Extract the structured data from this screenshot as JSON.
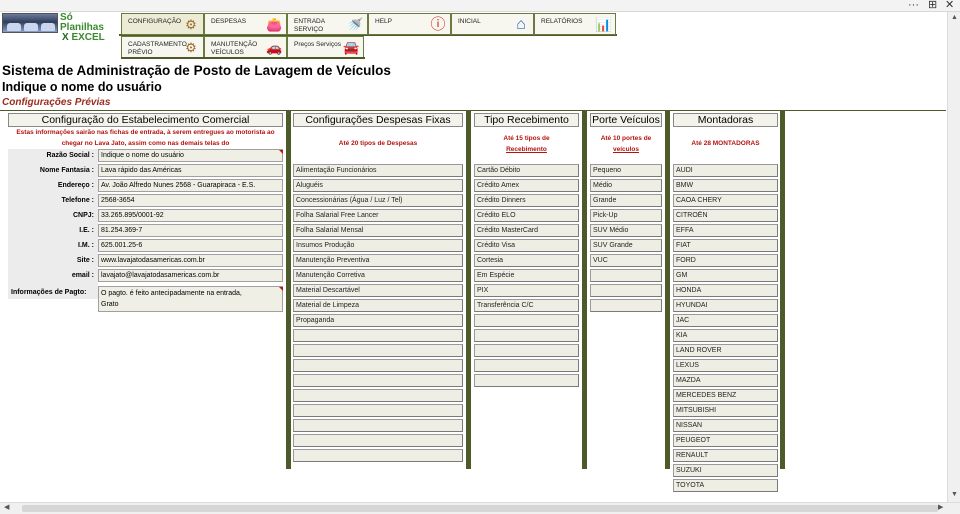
{
  "window": {
    "controls": [
      "···",
      "⊞",
      "✕"
    ]
  },
  "logo": {
    "line1": "Só Planilhas",
    "line2_x": "X",
    "line2": "EXCEL"
  },
  "menu": {
    "row1": [
      {
        "label": "CONFIGURAÇÃO",
        "icon": "gears-icon",
        "glyph": "⚙"
      },
      {
        "label": "DESPESAS",
        "icon": "wallet-icon",
        "glyph": "👛"
      },
      {
        "label": "ENTRADA SERVIÇO",
        "icon": "car-wash-icon",
        "glyph": "🚿"
      },
      {
        "label": "HELP",
        "icon": "info-icon",
        "glyph": "ⓘ"
      },
      {
        "label": "INICIAL",
        "icon": "home-icon",
        "glyph": "⌂"
      },
      {
        "label": "RELATÓRIOS",
        "icon": "report-icon",
        "glyph": "📊"
      }
    ],
    "row2": [
      {
        "label": "CADASTRAMENTO PRÉVIO",
        "icon": "gears-icon",
        "glyph": "⚙"
      },
      {
        "label": "MANUTENÇÃO VEÍCULOS",
        "icon": "car-check-icon",
        "glyph": "🚗"
      },
      {
        "label": "Preços Serviços",
        "icon": "car-price-icon",
        "glyph": "🚘"
      }
    ]
  },
  "page": {
    "title": "Sistema de Administração de Posto de Lavagem de Veículos",
    "user_prompt": "Indique o nome do usuário",
    "subtitle": "Configurações Prévias"
  },
  "establishment": {
    "header": "Configuração do Estabelecimento Comercial",
    "note": "Estas informações sairão nas fichas de entrada, à serem entregues ao motorista ao chegar no Lava Jato, assim como nas demais telas do",
    "fields": [
      {
        "label": "Razão Social :",
        "value": "Indique o nome do usuário"
      },
      {
        "label": "Nome Fantasia :",
        "value": "Lava rápido das Américas"
      },
      {
        "label": "Endereço :",
        "value": "Av. João Alfredo Nunes 2568 - Guarapiraca - E.S."
      },
      {
        "label": "Telefone :",
        "value": "2568-3654"
      },
      {
        "label": "CNPJ:",
        "value": "33.265.895/0001-92"
      },
      {
        "label": "I.E. :",
        "value": "81.254.369-7"
      },
      {
        "label": "I.M. :",
        "value": "625.001.25-6"
      },
      {
        "label": "Site :",
        "value": "www.lavajatodasamericas.com.br"
      },
      {
        "label": "email :",
        "value": "lavajato@lavajatodasamericas.com.br"
      }
    ],
    "payment_label": "Informações de Pagto:",
    "payment_line1": "O pagto. é feito antecipadamente na entrada,",
    "payment_line2": "Grato"
  },
  "expenses": {
    "header": "Configurações Despesas Fixas",
    "note": "Até 20 tipos de Despesas",
    "items": [
      "Alimentação Funcionários",
      "Aluguéis",
      "Concessionárias (Água / Luz / Tel)",
      "Folha Salarial Free Lancer",
      "Folha Salarial Mensal",
      "Insumos Produção",
      "Manutenção Preventiva",
      "Manutenção Corretiva",
      "Material Descartável",
      "Material de Limpeza",
      "Propaganda",
      "",
      "",
      "",
      "",
      "",
      "",
      "",
      "",
      ""
    ]
  },
  "receipt": {
    "header": "Tipo Recebimento",
    "note_line1": "Até 15 tipos de",
    "note_line2": "Recebimento",
    "items": [
      "Cartão Débito",
      "Crédito Amex",
      "Crédito Dinners",
      "Crédito ELO",
      "Crédito MasterCard",
      "Crédito Visa",
      "Cortesia",
      "Em Espécie",
      "PIX",
      "Transferência C/C",
      "",
      "",
      "",
      "",
      ""
    ]
  },
  "vehicle_size": {
    "header": "Porte Veículos",
    "note_line1": "Até 10 portes de",
    "note_line2": "veículos",
    "items": [
      "Pequeno",
      "Médio",
      "Grande",
      "Pick-Up",
      "SUV Médio",
      "SUV Grande",
      "VUC",
      "",
      "",
      ""
    ]
  },
  "brands": {
    "header": "Montadoras",
    "note": "Até 28 MONTADORAS",
    "items": [
      "AUDI",
      "BMW",
      "CAOA CHERY",
      "CITROËN",
      "EFFA",
      "FIAT",
      "FORD",
      "GM",
      "HONDA",
      "HYUNDAI",
      "JAC",
      "KIA",
      "LAND ROVER",
      "LEXUS",
      "MAZDA",
      "MERCEDES BENZ",
      "MITSUBISHI",
      "NISSAN",
      "PEUGEOT",
      "RENAULT",
      "SUZUKI",
      "TOYOTA"
    ]
  },
  "colors": {
    "olive": "#4d5a2a",
    "red_note": "#b3140f",
    "subtitle": "#9b2d1f"
  }
}
